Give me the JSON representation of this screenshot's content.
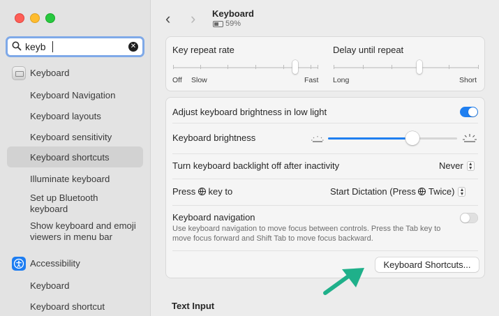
{
  "sidebar": {
    "search": {
      "value": "keyb",
      "clear_label": "✕"
    },
    "items": [
      {
        "label": "Keyboard"
      },
      {
        "label": "Keyboard Navigation"
      },
      {
        "label": "Keyboard layouts"
      },
      {
        "label": "Keyboard sensitivity"
      },
      {
        "label": "Keyboard shortcuts"
      },
      {
        "label": "Illuminate keyboard"
      },
      {
        "label": "Set up Bluetooth keyboard"
      },
      {
        "label": "Show keyboard and emoji viewers in menu bar"
      },
      {
        "label": "Accessibility"
      },
      {
        "label": "Keyboard"
      },
      {
        "label": "Keyboard shortcut"
      }
    ]
  },
  "header": {
    "back": "‹",
    "forward": "›",
    "title": "Keyboard",
    "battery": "59%"
  },
  "repeat": {
    "key_repeat_label": "Key repeat rate",
    "key_repeat_off": "Off",
    "key_repeat_slow": "Slow",
    "key_repeat_fast": "Fast",
    "key_repeat_level": 0.85,
    "delay_label": "Delay until repeat",
    "delay_long": "Long",
    "delay_short": "Short",
    "delay_level": 0.6
  },
  "settings": {
    "adjust_label": "Adjust keyboard brightness in low light",
    "adjust_on": true,
    "brightness_label": "Keyboard brightness",
    "brightness_level": 0.7,
    "backlight_label": "Turn keyboard backlight off after inactivity",
    "backlight_value": "Never",
    "press_key_pre": "Press",
    "press_key_post": "key to",
    "press_value_pre": "Start Dictation (Press",
    "press_value_post": "Twice)",
    "nav_label": "Keyboard navigation",
    "nav_desc": "Use keyboard navigation to move focus between controls. Press the Tab key to move focus forward and Shift Tab to move focus backward.",
    "nav_on": false,
    "shortcuts_button": "Keyboard Shortcuts..."
  },
  "text_input_heading": "Text Input",
  "colors": {
    "accent": "#1f7ff0",
    "arrow": "#1fb08a"
  }
}
